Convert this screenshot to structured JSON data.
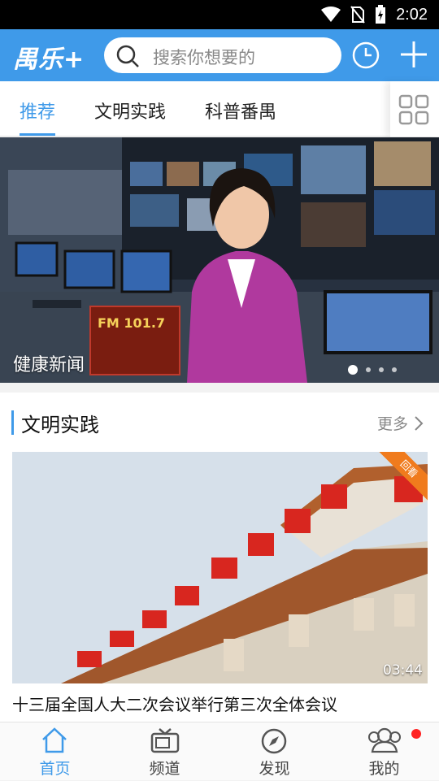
{
  "status_bar": {
    "time": "2:02",
    "icons": [
      "wifi-icon",
      "no-sim-icon",
      "battery-charging-icon"
    ]
  },
  "header": {
    "logo": "禺乐+",
    "search_placeholder": "搜索你想要的",
    "icons": [
      "search-icon",
      "history-clock-icon",
      "plus-icon"
    ]
  },
  "tabs": [
    {
      "label": "推荐",
      "active": true
    },
    {
      "label": "文明实践",
      "active": false
    },
    {
      "label": "科普番禺",
      "active": false
    }
  ],
  "banner": {
    "caption": "健康新闻",
    "sign_text": "FM 101.7",
    "page_count": 4,
    "active_page": 1
  },
  "section": {
    "title": "文明实践",
    "more_label": "更多",
    "video": {
      "corner_tag": "回看",
      "duration": "03:44",
      "title": "十三届全国人大二次会议举行第三次全体会议"
    }
  },
  "bottom_nav": [
    {
      "label": "首页",
      "icon": "home-icon",
      "active": true
    },
    {
      "label": "频道",
      "icon": "tv-icon",
      "active": false
    },
    {
      "label": "发现",
      "icon": "compass-icon",
      "active": false
    },
    {
      "label": "我的",
      "icon": "profile-icon",
      "active": false,
      "badge": true
    }
  ],
  "colors": {
    "brand": "#3f9ae9",
    "badge": "#ff2222",
    "corner_tag": "#f07b1d"
  }
}
